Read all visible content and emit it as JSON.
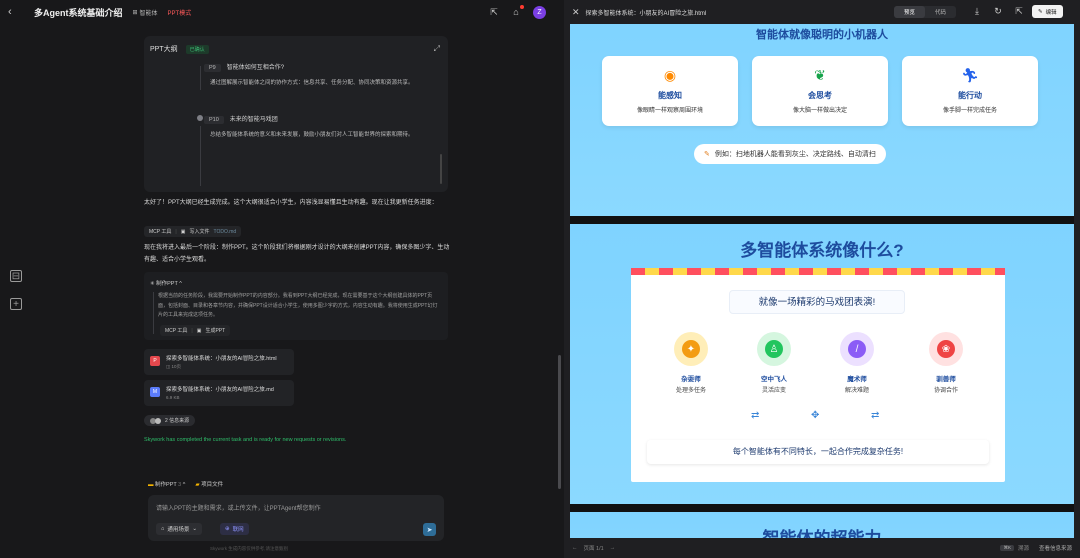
{
  "left_header": {
    "title": "多Agent系统基础介绍",
    "agent_label": "智能体",
    "mode_label": "PPT模式",
    "avatar_letter": "Z"
  },
  "outline": {
    "title": "PPT大纲",
    "status": "已确认",
    "items": [
      {
        "num": "P9",
        "title": "智能体如何互相合作?",
        "desc": "通过图解展示智能体之间的协作方式：信息共享、任务分配、协同决策和资源共享。"
      },
      {
        "num": "P10",
        "title": "未来的智能马戏团",
        "desc": "总结多智能体系统的意义和未来发展，鼓励小朋友们对人工智能世界的探索和期待。"
      }
    ]
  },
  "messages": {
    "m1": "太好了！PPT大纲已经生成完成。这个大纲很适合小学生，内容浅显易懂且生动有趣。现在让我更新任务进度：",
    "chip1": {
      "tool": "MCP 工具",
      "action": "写入文件",
      "file": "TODO.md"
    },
    "m2": "现在我将进入最后一个阶段：制作PPT。这个阶段我们将根据刚才设计的大纲来创建PPT内容，确保多图少字、生动有趣、适合小学生观看。",
    "thinking_title": "制作PPT",
    "thinking_text": "根据当前的任务阶段，我需要开始制作PPT的内容部分。我看到PPT大纲已经完成，现在需要基于这个大纲创建具体的PPT页面，包括封面、目录和各章节内容，并确保PPT设计适合小学生，使用多图少字的方式，内容生动有趣。我将使用生成PPT幻灯片的工具来完成这项任务。",
    "chip2": {
      "tool": "MCP 工具",
      "action": "生成PPT"
    },
    "files": [
      {
        "icon": "PPT",
        "color": "#e5484d",
        "name": "探索多智能体系统：小朋友的AI冒险之旅.html",
        "meta": "10页"
      },
      {
        "icon": "MD",
        "color": "#5b7cfa",
        "name": "探索多智能体系统：小朋友的AI冒险之旅.md",
        "meta": "6.9 KB"
      }
    ],
    "sources_label": "2 信息来源",
    "done_text": "Skywork has completed the current task and is ready for new requests or revisions."
  },
  "input": {
    "task_label": "制作PPT",
    "task_count": "3",
    "project_label": "项目文件",
    "placeholder": "请输入PPT的主题和需求，或上传文件，让PPTAgent帮您制作",
    "scene_label": "通用场景",
    "net_label": "联网",
    "footnote": "Skywork 生成内容仅供参考,请注意甄别"
  },
  "right_header": {
    "file_title": "探索多智能体系统：小朋友的AI冒险之旅.html",
    "tab_preview": "预览",
    "tab_code": "代码",
    "edit_label": "编辑"
  },
  "slide1": {
    "title": "智能体就像聪明的小机器人",
    "cards": [
      {
        "icon": "eye-icon",
        "title": "能感知",
        "desc": "像眼睛一样观察周围环境",
        "color": "#ff8a00"
      },
      {
        "icon": "brain-icon",
        "title": "会思考",
        "desc": "像大脑一样做出决定",
        "color": "#16a34a"
      },
      {
        "icon": "runner-icon",
        "title": "能行动",
        "desc": "像手脚一样完成任务",
        "color": "#2563eb"
      }
    ],
    "example": "例如：扫地机器人能看到灰尘、决定路线、自动清扫"
  },
  "slide2": {
    "title": "多智能体系统像什么?",
    "subtitle": "就像一场精彩的马戏团表演!",
    "acts": [
      {
        "title": "杂耍师",
        "desc": "处理多任务",
        "bg": "#ffeeb8",
        "fg": "#f39c12",
        "icon": "ball-icon"
      },
      {
        "title": "空中飞人",
        "desc": "灵活应变",
        "bg": "#d5f6df",
        "fg": "#22c55e",
        "icon": "person-icon"
      },
      {
        "title": "魔术师",
        "desc": "解决难题",
        "bg": "#ece0ff",
        "fg": "#8b5cf6",
        "icon": "wand-icon"
      },
      {
        "title": "驯兽师",
        "desc": "协调合作",
        "bg": "#ffe1e1",
        "fg": "#ef4444",
        "icon": "paw-icon"
      }
    ],
    "summary": "每个智能体有不同特长，一起合作完成复杂任务!"
  },
  "slide3": {
    "title": "智能体的超能力"
  },
  "footer": {
    "page": "页面 1/1",
    "hotkey": "⌘K",
    "source_label": "溯源",
    "source_link": "查看信息来源"
  }
}
